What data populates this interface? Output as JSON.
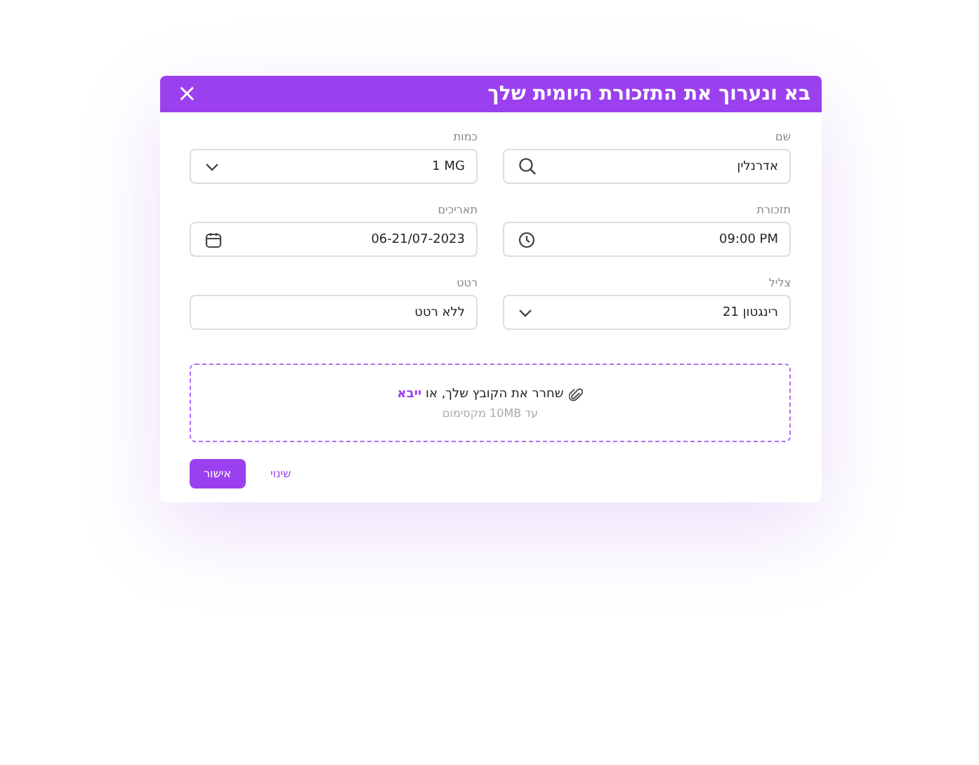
{
  "dialog": {
    "title": "בא ונערוך את התזכורת היומית שלך",
    "close": "×"
  },
  "fields": [
    {
      "label": "שם",
      "value": "אדרנלין",
      "kind": "search"
    },
    {
      "label": "כמות",
      "value": "1 MG",
      "kind": "select"
    },
    {
      "label": "תזכורת",
      "value": "09:00 PM",
      "kind": "time"
    },
    {
      "label": "תאריכים",
      "value": "06-21/07-2023",
      "kind": "date"
    },
    {
      "label": "צליל",
      "value": "רינגטון 21",
      "kind": "select"
    },
    {
      "label": "רטט",
      "value": "ללא רטט",
      "kind": "text"
    }
  ],
  "upload": {
    "text": "שחרר את הקובץ שלך, או",
    "link": "ייבא",
    "hint": "עד 10MB מקסימום"
  },
  "buttons": [
    {
      "label": "שינוי",
      "kind": "link"
    },
    {
      "label": "אישור",
      "kind": "primary"
    }
  ]
}
